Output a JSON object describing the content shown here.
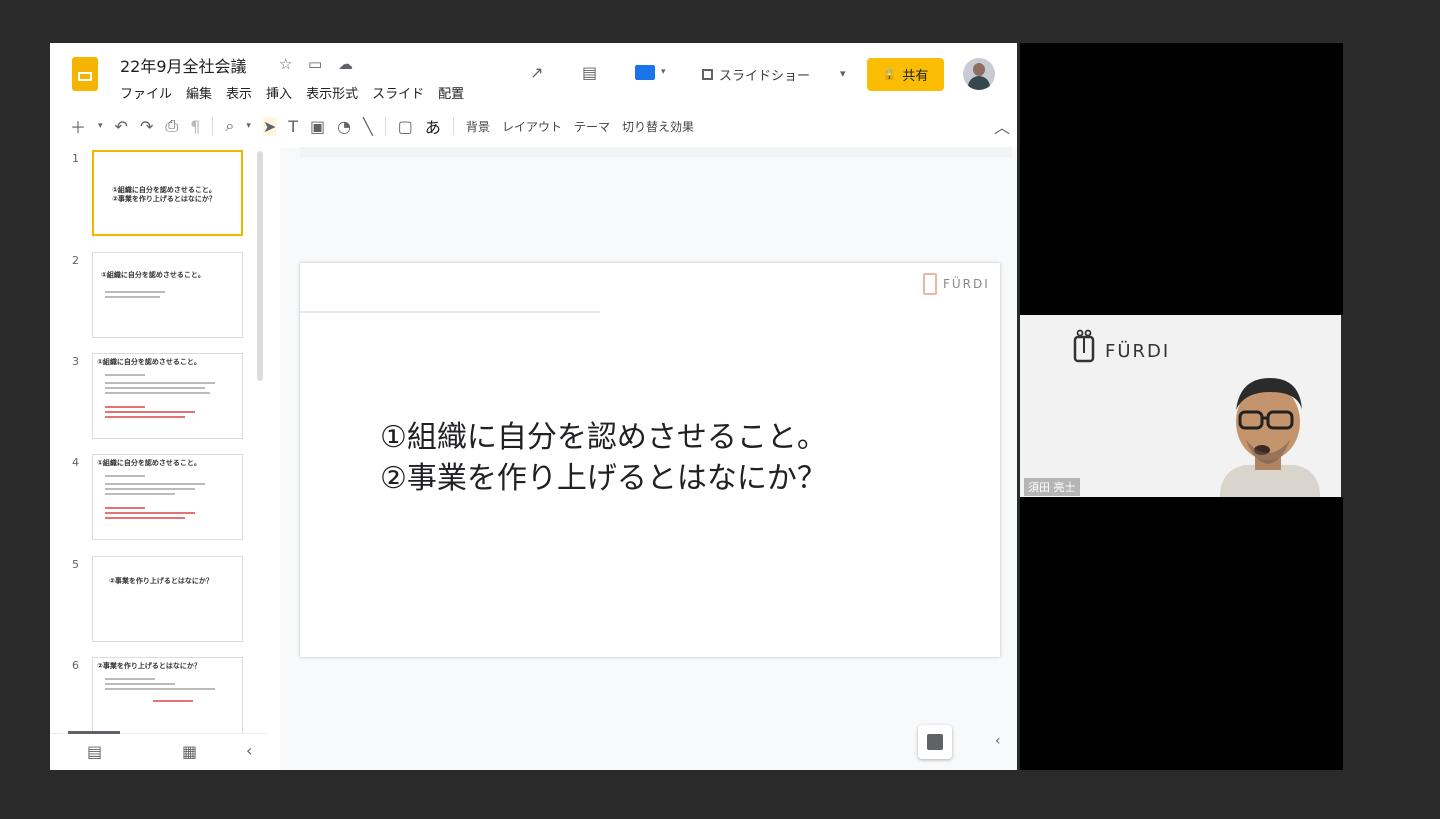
{
  "app": {
    "doc_title": "22年9月全社会議",
    "menu": [
      "ファイル",
      "編集",
      "表示",
      "挿入",
      "表示形式",
      "スライド",
      "配置"
    ],
    "present_label": "スライドショー",
    "share_label": "共有",
    "brand_color": "#f4b400",
    "share_color": "#fbbc04"
  },
  "toolbar": {
    "background_label": "背景",
    "layout_label": "レイアウト",
    "theme_label": "テーマ",
    "transition_label": "切り替え効果",
    "font_glyph": "あ"
  },
  "filmstrip": {
    "slides": [
      {
        "num": "1",
        "title": "①組織に自分を認めさせること。\n②事業を作り上げるとはなにか？"
      },
      {
        "num": "2",
        "title": "①組織に自分を認めさせること。"
      },
      {
        "num": "3",
        "title": "①組織に自分を認めさせること。"
      },
      {
        "num": "4",
        "title": "①組織に自分を認めさせること。"
      },
      {
        "num": "5",
        "title": "②事業を作り上げるとはなにか？"
      },
      {
        "num": "6",
        "title": "②事業を作り上げるとはなにか？"
      }
    ]
  },
  "slide": {
    "logo_text": "FÜRDI",
    "line1": "①組織に自分を認めさせること。",
    "line2": "②事業を作り上げるとはなにか？"
  },
  "video": {
    "logo_text": "FÜRDI",
    "name_tag": "須田 亮士"
  }
}
